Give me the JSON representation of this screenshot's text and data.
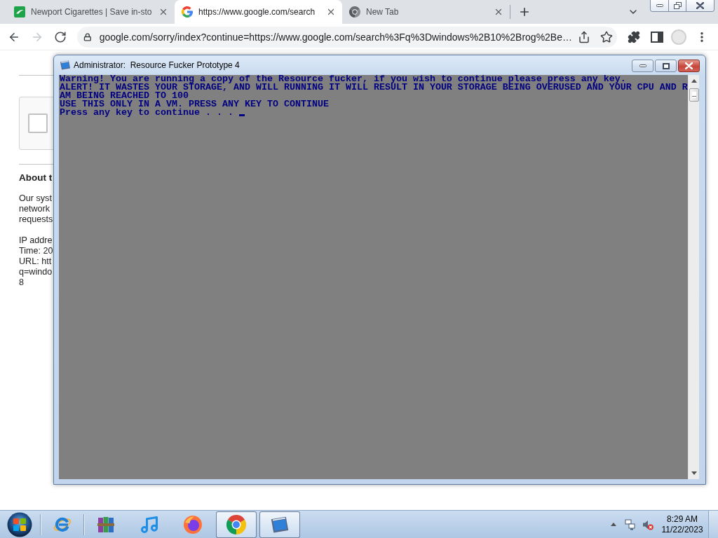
{
  "browser": {
    "tabs": [
      {
        "kind": "shop",
        "title": "Newport Cigarettes | Save in-sto",
        "selected": false
      },
      {
        "kind": "search",
        "title": "https://www.google.com/search",
        "selected": true
      },
      {
        "kind": "newtab",
        "title": "New Tab",
        "selected": false
      }
    ],
    "nav": [
      {
        "kind": "back",
        "disabled": false
      },
      {
        "kind": "forward",
        "disabled": true
      },
      {
        "kind": "reload",
        "disabled": false
      }
    ],
    "address": {
      "value": "google.com/sorry/index?continue=https://www.google.com/search%3Fq%3Dwindows%2B10%2Brog%2Be…"
    }
  },
  "page": {
    "captcha": {
      "checked": false
    },
    "heading": "About t",
    "paragraph": [
      "Our syst",
      "network",
      "requests"
    ],
    "details": [
      "IP addre",
      "Time: 20",
      "URL: htt",
      "q=windo",
      "8"
    ]
  },
  "console": {
    "title": "Administrator:  Resource Fucker Prototype 4",
    "lines": [
      "Warning! You are running a copy of the Resource fucker, if you wish to continue please press any key.",
      "ALERT! IT WASTES YOUR STORAGE, AND WILL RUNNING IT WILL RESULT IN YOUR STORAGE BEING OVERUSED AND YOUR CPU AND R",
      "AM BEING REACHED TO 100",
      "USE THIS ONLY IN A VM. PRESS ANY KEY TO CONTINUE",
      "Press any key to continue . . ."
    ],
    "cursor": true
  },
  "taskbar": {
    "items": [
      {
        "kind": "ie",
        "running": false
      },
      {
        "kind": "archive",
        "running": false
      },
      {
        "kind": "music",
        "running": false
      },
      {
        "kind": "firefox",
        "running": false
      },
      {
        "kind": "chrome",
        "running": true
      },
      {
        "kind": "console",
        "running": true
      }
    ],
    "clock": {
      "time": "8:29 AM",
      "date": "11/22/2023"
    }
  }
}
